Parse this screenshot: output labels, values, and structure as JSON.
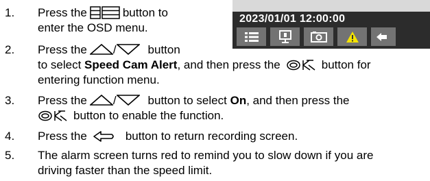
{
  "preview": {
    "timestamp": "2023/01/01  12:00:00",
    "buttons": [
      "menu-icon",
      "recording-icon",
      "camera-icon",
      "warning-icon",
      "return-icon"
    ]
  },
  "steps": [
    {
      "number": "1.",
      "line1_a": "Press the",
      "line1_b": "button to",
      "line2": "enter the OSD menu.",
      "icons": [
        "menu-button-icon"
      ]
    },
    {
      "number": "2.",
      "line1_a": "Press the",
      "slash": "/",
      "line1_b": "button",
      "line2_a": "to select",
      "line2_bold": "Speed Cam Alert",
      "line2_b": ", and then press the",
      "line2_c": "button for",
      "line3": "entering function menu.",
      "icons": [
        "up-icon",
        "down-icon",
        "ok-icon"
      ]
    },
    {
      "number": "3.",
      "line1_a": "Press the",
      "slash": "/",
      "line1_b": "button to select",
      "line1_bold": "On",
      "line1_c": ", and then press the",
      "line2": "button to enable the function.",
      "icons": [
        "up-icon",
        "down-icon",
        "ok-icon"
      ]
    },
    {
      "number": "4.",
      "line1_a": "Press the",
      "line1_b": "button to return recording screen.",
      "icons": [
        "return-button-icon"
      ]
    },
    {
      "number": "5.",
      "line1": "The alarm screen turns red to remind you to slow down if you are",
      "line2": "driving faster than the speed limit."
    }
  ],
  "colors": {
    "warning": "#f5e400",
    "button_bg": "#737373",
    "preview_bg": "#2c2c2c"
  }
}
